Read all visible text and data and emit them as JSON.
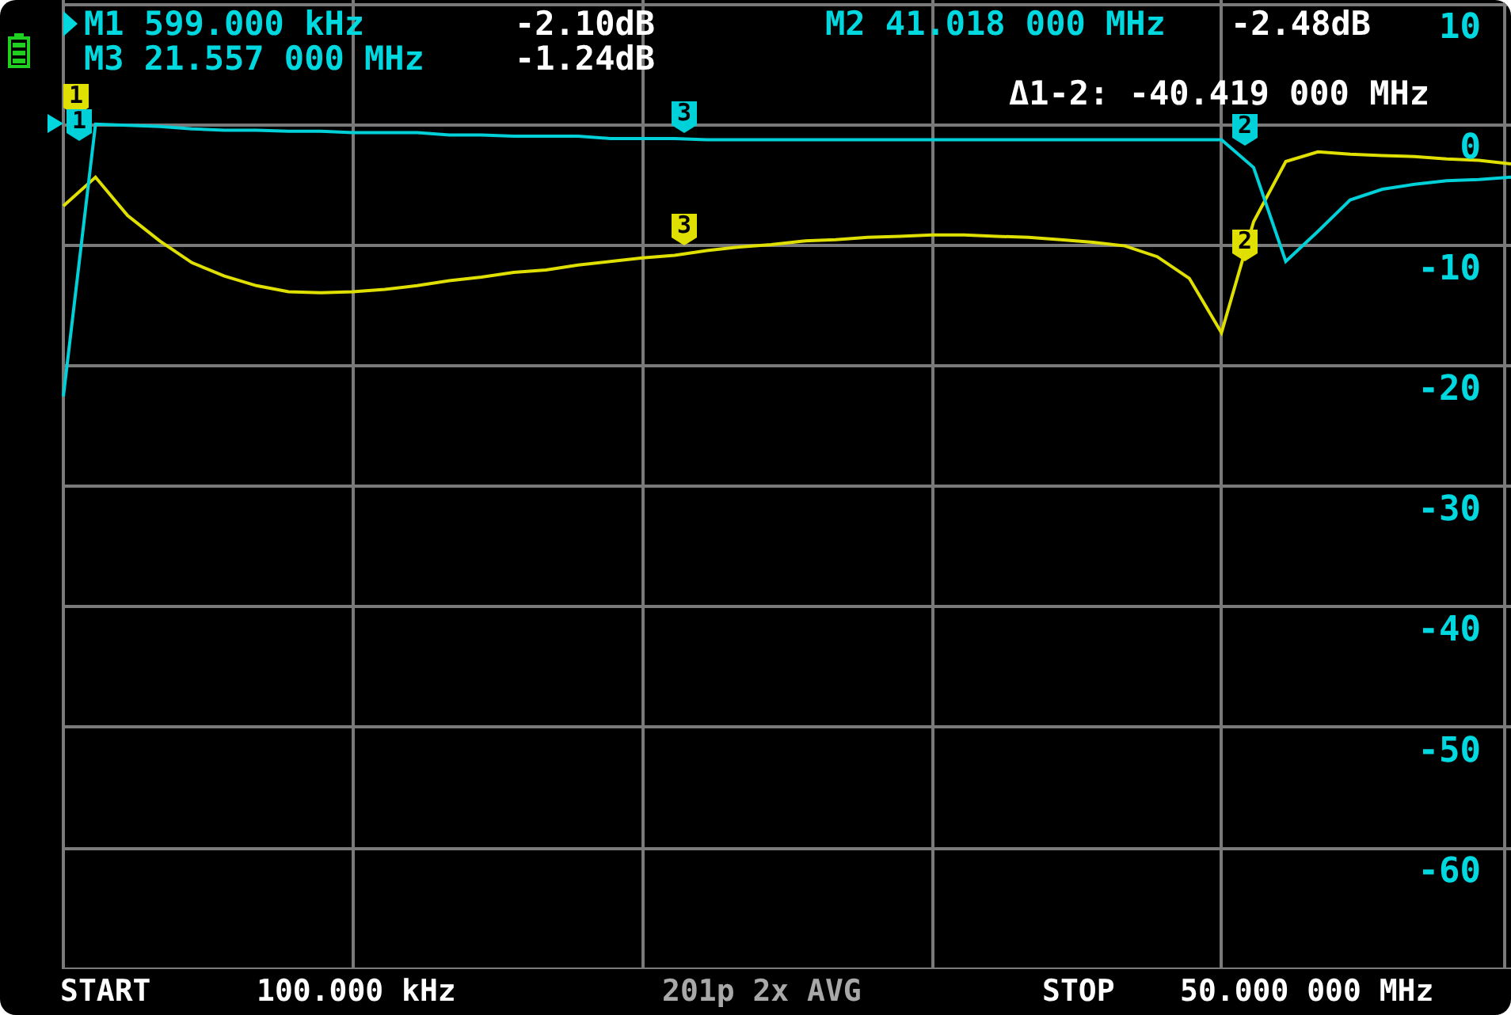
{
  "readouts": [
    {
      "label": "M1 599.000 kHz",
      "value": "-2.10dB",
      "selected": true
    },
    {
      "label": "M2 41.018 000 MHz",
      "value": "-2.48dB",
      "selected": false
    },
    {
      "label": "M3 21.557 000 MHz",
      "value": "-1.24dB",
      "selected": false
    }
  ],
  "delta": "Δ1-2: -40.419 000 MHz",
  "chart_data": {
    "type": "line",
    "categories": [
      null,
      null,
      null,
      null,
      null,
      null,
      null,
      null,
      null,
      null,
      null,
      null,
      null,
      null,
      null,
      null,
      null,
      null,
      null,
      null,
      null,
      null,
      null,
      null,
      null,
      null,
      null,
      null,
      null,
      null,
      null,
      null,
      null,
      null,
      null,
      null,
      null,
      null,
      null,
      null,
      null,
      null,
      null,
      null,
      null,
      null
    ],
    "series": [
      {
        "color": "#e0e000",
        "values": [
          -6.7,
          -4.3,
          -7.5,
          -9.6,
          -11.4,
          -12.5,
          -13.3,
          -13.8,
          -13.9,
          -13.8,
          -13.6,
          -13.3,
          -12.9,
          -12.6,
          -12.2,
          -12.0,
          -11.6,
          -11.3,
          -11.0,
          -10.8,
          -10.4,
          -10.1,
          -9.9,
          -9.6,
          -9.5,
          -9.3,
          -9.2,
          -9.1,
          -9.1,
          -9.2,
          -9.3,
          -9.5,
          -9.7,
          -10.0,
          -10.9,
          -12.7,
          -17.2,
          -8.0,
          -3.0,
          -2.2,
          -2.4,
          -2.5,
          -2.6,
          -2.8,
          -2.9,
          -3.2
        ]
      },
      {
        "color": "#00d0d8",
        "values": [
          -22.5,
          0.1,
          0,
          -0.1,
          -0.3,
          -0.4,
          -0.4,
          -0.5,
          -0.5,
          -0.6,
          -0.6,
          -0.6,
          -0.8,
          -0.8,
          -0.9,
          -0.9,
          -0.9,
          -1.1,
          -1.1,
          -1.1,
          -1.2,
          -1.2,
          -1.2,
          -1.2,
          -1.2,
          -1.2,
          -1.2,
          -1.2,
          -1.2,
          -1.2,
          -1.2,
          -1.2,
          -1.2,
          -1.2,
          -1.2,
          -1.2,
          -1.2,
          -3.5,
          -11.3,
          -8.8,
          -6.2,
          -5.3,
          -4.9,
          -4.6,
          -4.5,
          -4.3
        ]
      }
    ],
    "ylim": [
      -70,
      10
    ],
    "grid": true,
    "yticks": [
      10,
      0,
      -10,
      -20,
      -30,
      -40,
      -50,
      -60
    ]
  },
  "traces": [
    {
      "markers": [
        {
          "label": "1"
        },
        {
          "label": "2"
        },
        {
          "label": "3"
        }
      ]
    },
    {
      "markers": [
        {
          "label": "1"
        },
        {
          "label": "2"
        },
        {
          "label": "3"
        }
      ]
    }
  ],
  "footer": {
    "start_label": "START",
    "start": "100.000 kHz",
    "info": "201p 2x AVG",
    "stop_label": "STOP",
    "stop": "50.000 000 MHz"
  }
}
